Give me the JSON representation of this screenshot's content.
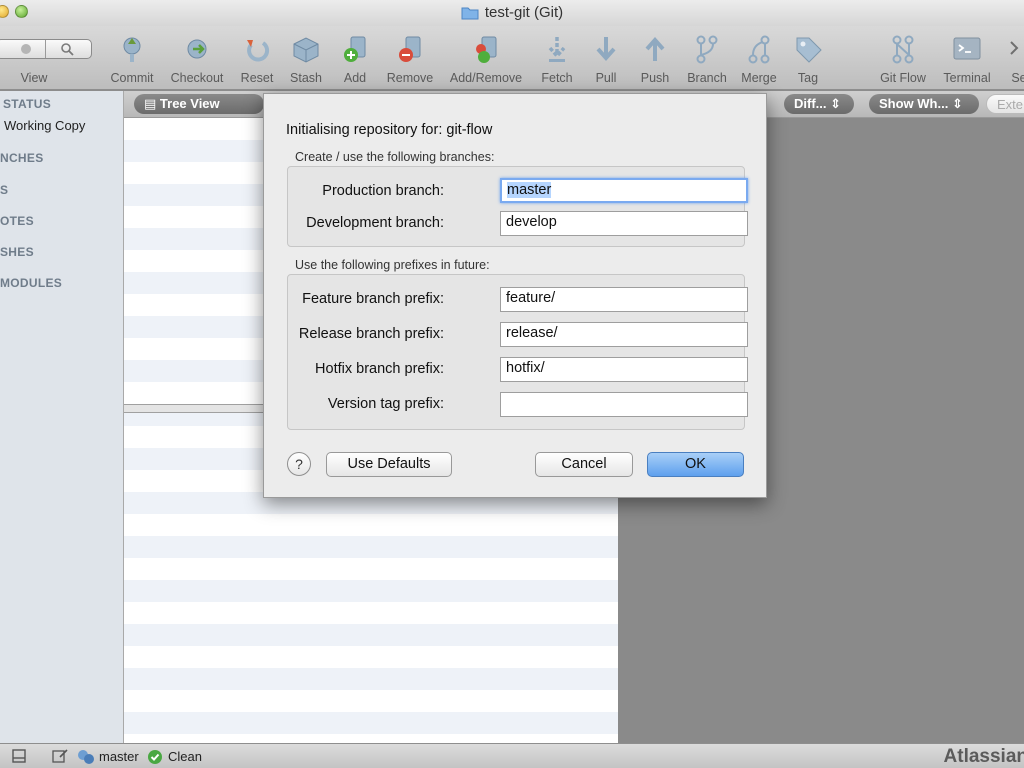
{
  "window": {
    "title": "test-git (Git)"
  },
  "toolbar": {
    "items": [
      {
        "label": "View",
        "icon": "view-search-icon"
      },
      {
        "label": "Commit",
        "icon": "commit-icon"
      },
      {
        "label": "Checkout",
        "icon": "checkout-icon"
      },
      {
        "label": "Reset",
        "icon": "reset-icon"
      },
      {
        "label": "Stash",
        "icon": "stash-icon"
      },
      {
        "label": "Add",
        "icon": "add-icon"
      },
      {
        "label": "Remove",
        "icon": "remove-icon"
      },
      {
        "label": "Add/Remove",
        "icon": "add-remove-icon"
      },
      {
        "label": "Fetch",
        "icon": "fetch-icon"
      },
      {
        "label": "Pull",
        "icon": "pull-icon"
      },
      {
        "label": "Push",
        "icon": "push-icon"
      },
      {
        "label": "Branch",
        "icon": "branch-icon"
      },
      {
        "label": "Merge",
        "icon": "merge-icon"
      },
      {
        "label": "Tag",
        "icon": "tag-icon"
      },
      {
        "label": "Git Flow",
        "icon": "git-flow-icon"
      },
      {
        "label": "Terminal",
        "icon": "terminal-icon"
      },
      {
        "label": "Se",
        "icon": "settings-icon"
      }
    ]
  },
  "sidebar": {
    "sections": [
      {
        "label": "STATUS"
      },
      {
        "label": "NCHES"
      },
      {
        "label": "S"
      },
      {
        "label": "OTES"
      },
      {
        "label": "SHES"
      },
      {
        "label": "MODULES"
      }
    ],
    "working_copy": "Working Copy"
  },
  "subbar": {
    "tree_view": "Tree View",
    "diff": "Diff...",
    "show_what": "Show Wh...",
    "external": "Exte"
  },
  "dialog": {
    "title_prefix": "Initialising repository for:",
    "repo_name": "git-flow",
    "branches_caption": "Create / use the following branches:",
    "production_label": "Production branch:",
    "production_value": "master",
    "development_label": "Development branch:",
    "development_value": "develop",
    "prefixes_caption": "Use the following prefixes in future:",
    "feature_label": "Feature branch prefix:",
    "feature_value": "feature/",
    "release_label": "Release branch prefix:",
    "release_value": "release/",
    "hotfix_label": "Hotfix branch prefix:",
    "hotfix_value": "hotfix/",
    "version_label": "Version tag prefix:",
    "version_value": "",
    "help": "?",
    "use_defaults": "Use Defaults",
    "cancel": "Cancel",
    "ok": "OK"
  },
  "statusbar": {
    "branch": "master",
    "state": "Clean",
    "brand": "Atlassian"
  },
  "colors": {
    "ok_button": "#5ea0ee",
    "focus_ring": "#7aaaf0",
    "clean_badge": "#4aa843"
  }
}
